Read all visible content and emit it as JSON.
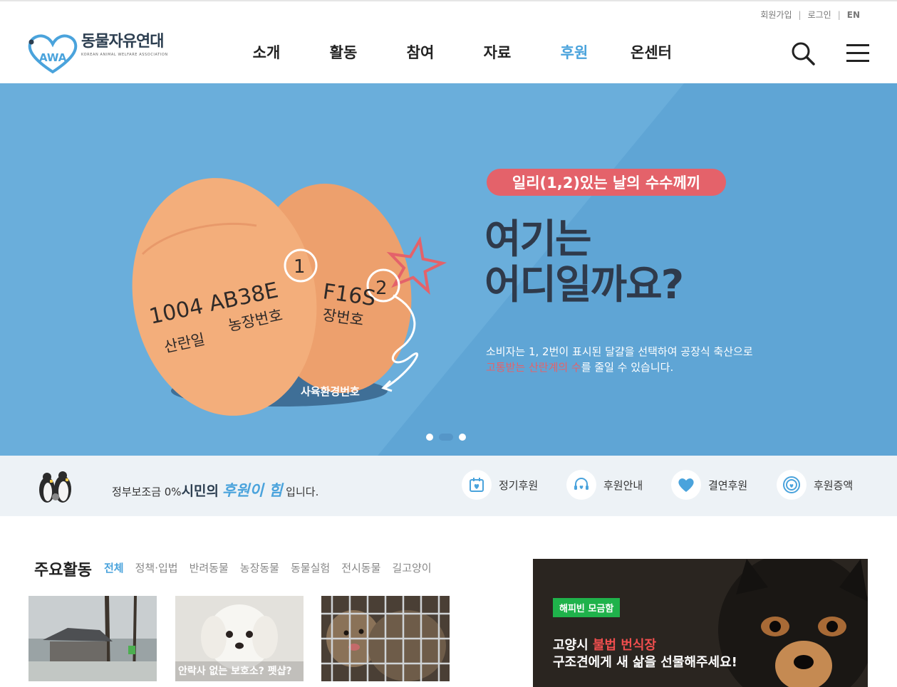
{
  "util": {
    "signup": "회원가입",
    "login": "로그인",
    "lang": "EN"
  },
  "logo": {
    "mark": "AWA",
    "title": "동물자유연대",
    "subtitle": "KOREAN ANIMAL WELFARE ASSOCIATION"
  },
  "nav": {
    "items": [
      "소개",
      "활동",
      "참여",
      "자료",
      "후원",
      "온센터"
    ],
    "active": "후원"
  },
  "hero": {
    "tag": "일리(1,2)있는 날의 수수께끼",
    "title_line1": "여기는",
    "title_line2": "어디일까요?",
    "desc_line1": "소비자는 1, 2번이 표시된 달걀을 선택하여 공장식 축산으로",
    "desc_red": "고통받는 산란계의 수",
    "desc_rest": "를 줄일 수 있습니다.",
    "egg_code": "1004 AB38E",
    "egg_num1": "1",
    "egg_code2": "F16S",
    "egg_num2": "2",
    "egg_label1": "산란일",
    "egg_label2": "농장번호",
    "egg_label3": "장번호",
    "egg_label4": "사육환경번호",
    "slide_count": 3,
    "active_slide": 2
  },
  "strip": {
    "text_prefix": "정부보조금 0%",
    "text_hl": "시민의",
    "text_hl2": "후원이 힘",
    "text_suffix": " 입니다.",
    "buttons": [
      {
        "label": "정기후원",
        "icon": "calendar-heart-icon"
      },
      {
        "label": "후원안내",
        "icon": "headset-icon"
      },
      {
        "label": "결연후원",
        "icon": "heart-icon"
      },
      {
        "label": "후원증액",
        "icon": "target-heart-icon"
      }
    ]
  },
  "activities": {
    "title": "주요활동",
    "tabs": [
      "전체",
      "정책·입법",
      "반려동물",
      "농장동물",
      "동물실험",
      "전시동물",
      "길고양이"
    ],
    "active_tab": "전체",
    "thumb2_caption": "안락사 없는 보호소? 펫샵?"
  },
  "banner": {
    "badge": "해피빈 모금함",
    "line1_prefix": "고양시 ",
    "line1_red": "불법 번식장",
    "line2": "구조견에게 새 삶을 선물해주세요!"
  },
  "colors": {
    "accent": "#4aa3dc",
    "hero_bg": "#6aaedb",
    "tag_red": "#e4626a",
    "strip_bg": "#edf2f6",
    "happybean_green": "#1fb24b"
  }
}
